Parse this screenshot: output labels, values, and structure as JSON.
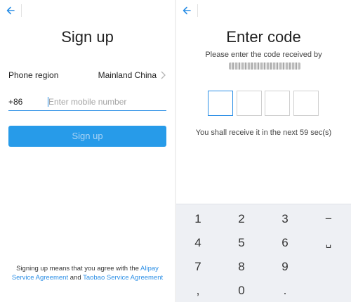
{
  "signup_screen": {
    "title": "Sign up",
    "region_label": "Phone region",
    "region_value": "Mainland China",
    "country_code": "+86",
    "phone_placeholder": "Enter mobile number",
    "signup_button_label": "Sign up",
    "agreement_text": "Signing up means that you agree with the",
    "agreement_link_1": "Alipay Service Agreement",
    "agreement_and": "and",
    "agreement_link_2": "Taobao Service Agreement"
  },
  "code_screen": {
    "title": "Enter code",
    "instruction": "Please enter the code received by",
    "timer_text": "You shall receive it in the next 59 sec(s)"
  },
  "keypad": {
    "rows": [
      [
        "1",
        "2",
        "3",
        "−"
      ],
      [
        "4",
        "5",
        "6",
        "␣"
      ],
      [
        "7",
        "8",
        "9",
        ""
      ],
      [
        ",",
        "0",
        ".",
        ""
      ]
    ]
  },
  "colors": {
    "accent": "#2c8fe6",
    "button_bg": "#279be9",
    "keypad_bg": "#eef0f4"
  },
  "icons": {
    "back": "back-arrow-icon",
    "chevron": "chevron-right-icon"
  }
}
